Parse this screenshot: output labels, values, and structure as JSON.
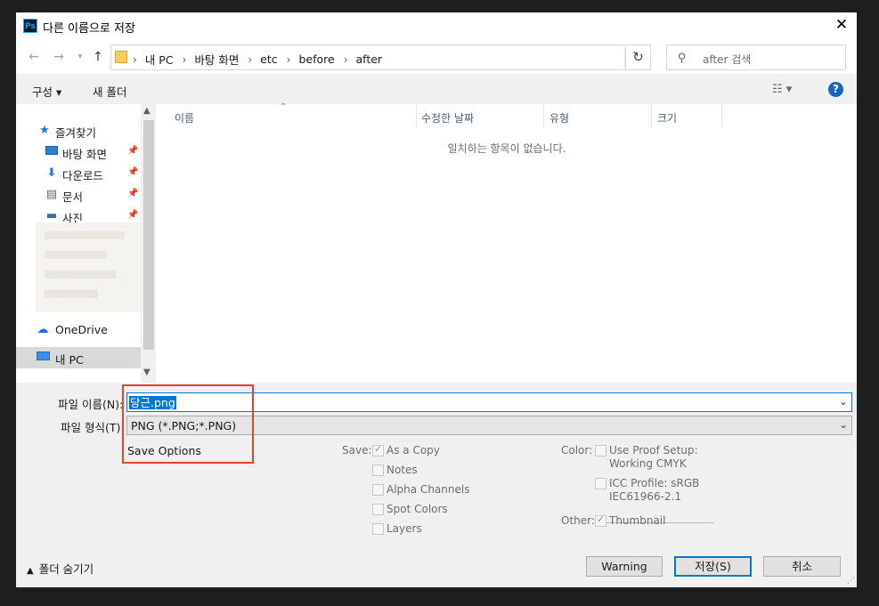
{
  "window": {
    "title": "다른 이름으로 저장",
    "app_icon": "Ps"
  },
  "nav": {
    "crumbs": [
      "내 PC",
      "바탕 화면",
      "etc",
      "before",
      "after"
    ],
    "search_placeholder": "after 검색"
  },
  "toolbar": {
    "organize": "구성 ▾",
    "new_folder": "새 폴더"
  },
  "sidebar": {
    "favorites": "즐겨찾기",
    "items": [
      {
        "label": "바탕 화면",
        "icon": "desktop-icon"
      },
      {
        "label": "다운로드",
        "icon": "download-icon"
      },
      {
        "label": "문서",
        "icon": "document-icon"
      },
      {
        "label": "사진",
        "icon": "pictures-icon"
      }
    ],
    "onedrive": "OneDrive",
    "this_pc": "내 PC"
  },
  "columns": [
    "이름",
    "수정한 날짜",
    "유형",
    "크기"
  ],
  "empty_message": "일치하는 항목이 없습니다.",
  "form": {
    "filename_label": "파일 이름(N):",
    "filename_value": "당근.png",
    "format_label": "파일 형식(T):",
    "format_value": "PNG (*.PNG;*.PNG)",
    "save_options": "Save Options"
  },
  "save_opts": {
    "save_label": "Save:",
    "as_copy": "As a Copy",
    "notes": "Notes",
    "alpha": "Alpha Channels",
    "spot": "Spot Colors",
    "layers": "Layers",
    "color_label": "Color:",
    "proof_1": "Use Proof Setup:",
    "proof_2": "Working CMYK",
    "icc_1": "ICC Profile:  sRGB",
    "icc_2": "IEC61966-2.1",
    "other_label": "Other:",
    "thumbnail": "Thumbnail"
  },
  "footer": {
    "hide_folders": "폴더 숨기기",
    "warning": "Warning",
    "save": "저장(S)",
    "cancel": "취소"
  },
  "colors": {
    "accent": "#0078d7",
    "highlight_box": "#e8432f"
  }
}
